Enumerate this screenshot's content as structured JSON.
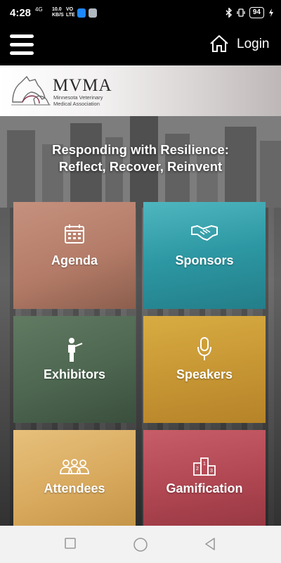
{
  "status_bar": {
    "time": "4:28",
    "signal_label": "4G",
    "speed_value": "10.0",
    "speed_unit": "KB/S",
    "volte_top": "VO",
    "volte_bottom": "LTE",
    "battery": "94"
  },
  "header": {
    "login_label": "Login",
    "menu_icon": "hamburger-menu-icon",
    "home_icon": "home-icon"
  },
  "logo": {
    "title": "MVMA",
    "subtitle": "Minnesota Veterinary Medical Association"
  },
  "hero": {
    "title_line1": "Responding with Resilience:",
    "title_line2": "Reflect, Recover, Reinvent"
  },
  "tiles": [
    {
      "label": "Agenda",
      "icon": "calendar-icon",
      "color": "#b47c68"
    },
    {
      "label": "Sponsors",
      "icon": "handshake-icon",
      "color": "#2c97a2"
    },
    {
      "label": "Exhibitors",
      "icon": "presenter-icon",
      "color": "#4d6650"
    },
    {
      "label": "Speakers",
      "icon": "microphone-icon",
      "color": "#c69533"
    },
    {
      "label": "Attendees",
      "icon": "people-group-icon",
      "color": "#d7a85c"
    },
    {
      "label": "Gamification",
      "icon": "podium-icon",
      "color": "#b04752"
    }
  ],
  "nav_bar": {
    "recent_icon": "square-recents-icon",
    "home_icon": "circle-home-icon",
    "back_icon": "triangle-back-icon"
  }
}
